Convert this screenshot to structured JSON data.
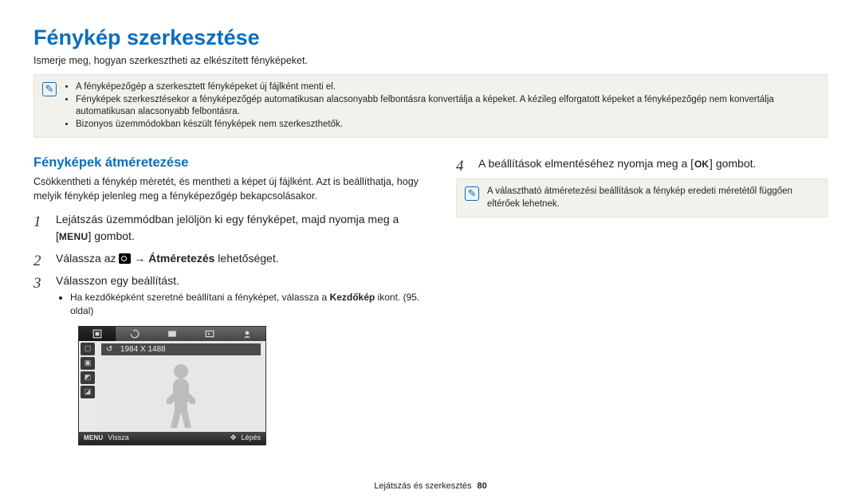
{
  "title": "Fénykép szerkesztése",
  "intro": "Ismerje meg, hogyan szerkesztheti az elkészített fényképeket.",
  "top_note_icon": "✎",
  "top_notes": [
    "A fényképezőgép a szerkesztett fényképeket új fájlként menti el.",
    "Fényképek szerkesztésekor a fényképezőgép automatikusan alacsonyabb felbontásra konvertálja a képeket. A kézileg elforgatott képeket a fényképezőgép nem konvertálja automatikusan alacsonyabb felbontásra.",
    "Bizonyos üzemmódokban készült fényképek nem szerkeszthetők."
  ],
  "left": {
    "heading": "Fényképek átméretezése",
    "desc": "Csökkentheti a fénykép méretét, és mentheti a képet új fájlként. Azt is beállíthatja, hogy melyik fénykép jelenleg meg a fényképezőgép bekapcsolásakor.",
    "step1_a": "Lejátszás üzemmódban jelöljön ki egy fényképet, majd nyomja meg a [",
    "step1_menu": "MENU",
    "step1_b": "] gombot.",
    "step2_a": "Válassza az ",
    "step2_arrow": " → ",
    "step2_bold": "Átméretezés",
    "step2_b": " lehetőséget.",
    "step3": "Válasszon egy beállítást.",
    "step3_sub_a": "Ha kezdőképként szeretné beállítani a fényképet, válassza a ",
    "step3_sub_bold": "Kezdőkép",
    "step3_sub_b": " ikont. (95. oldal)",
    "camera": {
      "resolution": "1984 X 1488",
      "footer_menu": "MENU",
      "footer_back": "Vissza",
      "footer_step": "Lépés"
    }
  },
  "right": {
    "step4_a": "A beállítások elmentéséhez nyomja meg a [",
    "step4_ok": "OK",
    "step4_b": "] gombot.",
    "note": "A választható átméretezési beállítások a fénykép eredeti méretétől függően eltérőek lehetnek."
  },
  "footer": {
    "section": "Lejátszás és szerkesztés",
    "page": "80"
  }
}
